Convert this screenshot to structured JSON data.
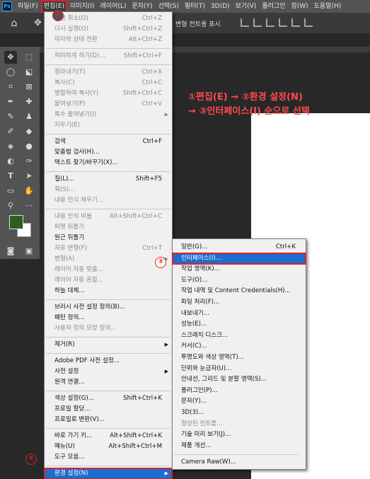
{
  "app": {
    "logo": "Ps"
  },
  "menubar": {
    "items": [
      "파일(F)",
      "편집(E)",
      "이미지(I)",
      "레이어(L)",
      "문자(Y)",
      "선택(S)",
      "필터(T)",
      "3D(D)",
      "보기(V)",
      "플러그인",
      "창(W)",
      "도움말(H)"
    ]
  },
  "options_bar": {
    "transform_controls": "변형 컨트롤 표시"
  },
  "annotation": {
    "line1": "①편집(E) → ②환경 설정(N)",
    "line2": "→ ③인터페이스(I) 순으로 선택"
  },
  "badges": {
    "b1": "①",
    "b2": "②",
    "b3": "③"
  },
  "edit_menu": [
    {
      "label": "실행 취소(O)",
      "shortcut": "Ctrl+Z",
      "disabled": true
    },
    {
      "label": "다시 실행(O)",
      "shortcut": "Shift+Ctrl+Z",
      "disabled": true
    },
    {
      "label": "마지막 상태 전환",
      "shortcut": "Alt+Ctrl+Z",
      "disabled": true
    },
    {
      "sep": true
    },
    {
      "label": "희미하게 하기(D)...",
      "shortcut": "Shift+Ctrl+F",
      "disabled": true
    },
    {
      "sep": true
    },
    {
      "label": "잘라내기(T)",
      "shortcut": "Ctrl+X",
      "disabled": true
    },
    {
      "label": "복사(C)",
      "shortcut": "Ctrl+C",
      "disabled": true
    },
    {
      "label": "병합하여 복사(Y)",
      "shortcut": "Shift+Ctrl+C",
      "disabled": true
    },
    {
      "label": "붙여넣기(P)",
      "shortcut": "Ctrl+V",
      "disabled": true
    },
    {
      "label": "특수 붙여넣기(I)",
      "shortcut": "",
      "disabled": true,
      "submenu": true
    },
    {
      "label": "지우기(E)",
      "shortcut": "",
      "disabled": true
    },
    {
      "sep": true
    },
    {
      "label": "검색",
      "shortcut": "Ctrl+F",
      "disabled": false
    },
    {
      "label": "맞춤법 검사(H)...",
      "shortcut": "",
      "disabled": false
    },
    {
      "label": "텍스트 찾기/바꾸기(X)...",
      "shortcut": "",
      "disabled": false
    },
    {
      "sep": true
    },
    {
      "label": "칠(L)...",
      "shortcut": "Shift+F5",
      "disabled": false
    },
    {
      "label": "획(S)...",
      "shortcut": "",
      "disabled": true
    },
    {
      "label": "내용 인식 채우기...",
      "shortcut": "",
      "disabled": true
    },
    {
      "sep": true
    },
    {
      "label": "내용 인식 비율",
      "shortcut": "Alt+Shift+Ctrl+C",
      "disabled": true
    },
    {
      "label": "퍼펫 뒤틀기",
      "shortcut": "",
      "disabled": true
    },
    {
      "label": "원근 뒤틀기",
      "shortcut": "",
      "disabled": false
    },
    {
      "label": "자유 변형(F)",
      "shortcut": "Ctrl+T",
      "disabled": true
    },
    {
      "label": "변형(A)",
      "shortcut": "",
      "disabled": true,
      "submenu": true
    },
    {
      "label": "레이어 자동 맞춤...",
      "shortcut": "",
      "disabled": true
    },
    {
      "label": "레이어 자동 혼합...",
      "shortcut": "",
      "disabled": true
    },
    {
      "label": "하늘 대체...",
      "shortcut": "",
      "disabled": false
    },
    {
      "sep": true
    },
    {
      "label": "브러시 사전 설정 정의(B)...",
      "shortcut": "",
      "disabled": false
    },
    {
      "label": "패턴 정의...",
      "shortcut": "",
      "disabled": false
    },
    {
      "label": "사용자 정의 모양 정의...",
      "shortcut": "",
      "disabled": true
    },
    {
      "sep": true
    },
    {
      "label": "제거(R)",
      "shortcut": "",
      "disabled": false,
      "submenu": true
    },
    {
      "sep": true
    },
    {
      "label": "Adobe PDF 사전 설정...",
      "shortcut": "",
      "disabled": false
    },
    {
      "label": "사전 설정",
      "shortcut": "",
      "disabled": false,
      "submenu": true
    },
    {
      "label": "원격 연결...",
      "shortcut": "",
      "disabled": false
    },
    {
      "sep": true
    },
    {
      "label": "색상 설정(G)...",
      "shortcut": "Shift+Ctrl+K",
      "disabled": false
    },
    {
      "label": "프로필 할당...",
      "shortcut": "",
      "disabled": false
    },
    {
      "label": "프로필로 변환(V)...",
      "shortcut": "",
      "disabled": false
    },
    {
      "sep": true
    },
    {
      "label": "바로 가기 키...",
      "shortcut": "Alt+Shift+Ctrl+K",
      "disabled": false
    },
    {
      "label": "메뉴(U)",
      "shortcut": "Alt+Shift+Ctrl+M",
      "disabled": false
    },
    {
      "label": "도구 모음...",
      "shortcut": "",
      "disabled": false
    },
    {
      "sep": true
    },
    {
      "label": "환경 설정(N)",
      "shortcut": "",
      "disabled": false,
      "submenu": true,
      "highlighted": true
    }
  ],
  "preferences_submenu": [
    {
      "label": "일반(G)...",
      "shortcut": "Ctrl+K",
      "disabled": false
    },
    {
      "label": "인터페이스(I)...",
      "shortcut": "",
      "disabled": false,
      "highlighted": true
    },
    {
      "label": "작업 영역(K)...",
      "shortcut": "",
      "disabled": false
    },
    {
      "label": "도구(O)...",
      "shortcut": "",
      "disabled": false
    },
    {
      "label": "작업 내역 및 Content Credentials(H)...",
      "shortcut": "",
      "disabled": false
    },
    {
      "label": "파일 처리(F)...",
      "shortcut": "",
      "disabled": false
    },
    {
      "label": "내보내기...",
      "shortcut": "",
      "disabled": false
    },
    {
      "label": "성능(E)...",
      "shortcut": "",
      "disabled": false
    },
    {
      "label": "스크래치 디스크...",
      "shortcut": "",
      "disabled": false
    },
    {
      "label": "커서(C)...",
      "shortcut": "",
      "disabled": false
    },
    {
      "label": "투명도와 색상 영역(T)...",
      "shortcut": "",
      "disabled": false
    },
    {
      "label": "단위와 눈금자(U)...",
      "shortcut": "",
      "disabled": false
    },
    {
      "label": "안내선, 그리드 및 분할 영역(S)...",
      "shortcut": "",
      "disabled": false
    },
    {
      "label": "플러그인(P)...",
      "shortcut": "",
      "disabled": false
    },
    {
      "label": "문자(Y)...",
      "shortcut": "",
      "disabled": false
    },
    {
      "label": "3D(3)...",
      "shortcut": "",
      "disabled": false
    },
    {
      "label": "향상된 컨트롤...",
      "shortcut": "",
      "disabled": true
    },
    {
      "label": "기술 미리 보기(J)...",
      "shortcut": "",
      "disabled": false
    },
    {
      "label": "제품 개선...",
      "shortcut": "",
      "disabled": false
    },
    {
      "sep": true
    },
    {
      "label": "Camera Raw(W)...",
      "shortcut": "",
      "disabled": false
    }
  ],
  "tools": [
    "move-tool",
    "marquee-tool",
    "lasso-tool",
    "object-select-tool",
    "crop-tool",
    "frame-tool",
    "eyedropper-tool",
    "healing-tool",
    "brush-tool",
    "stamp-tool",
    "history-brush-tool",
    "eraser-tool",
    "gradient-tool",
    "blur-tool",
    "dodge-tool",
    "pen-tool",
    "type-tool",
    "path-select-tool",
    "rectangle-tool",
    "hand-tool",
    "zoom-tool"
  ],
  "colors": {
    "foreground": "#2c5e1e",
    "background": "#ffffff",
    "highlight": "#1c6dd0",
    "annotation_red": "#e0202a"
  }
}
